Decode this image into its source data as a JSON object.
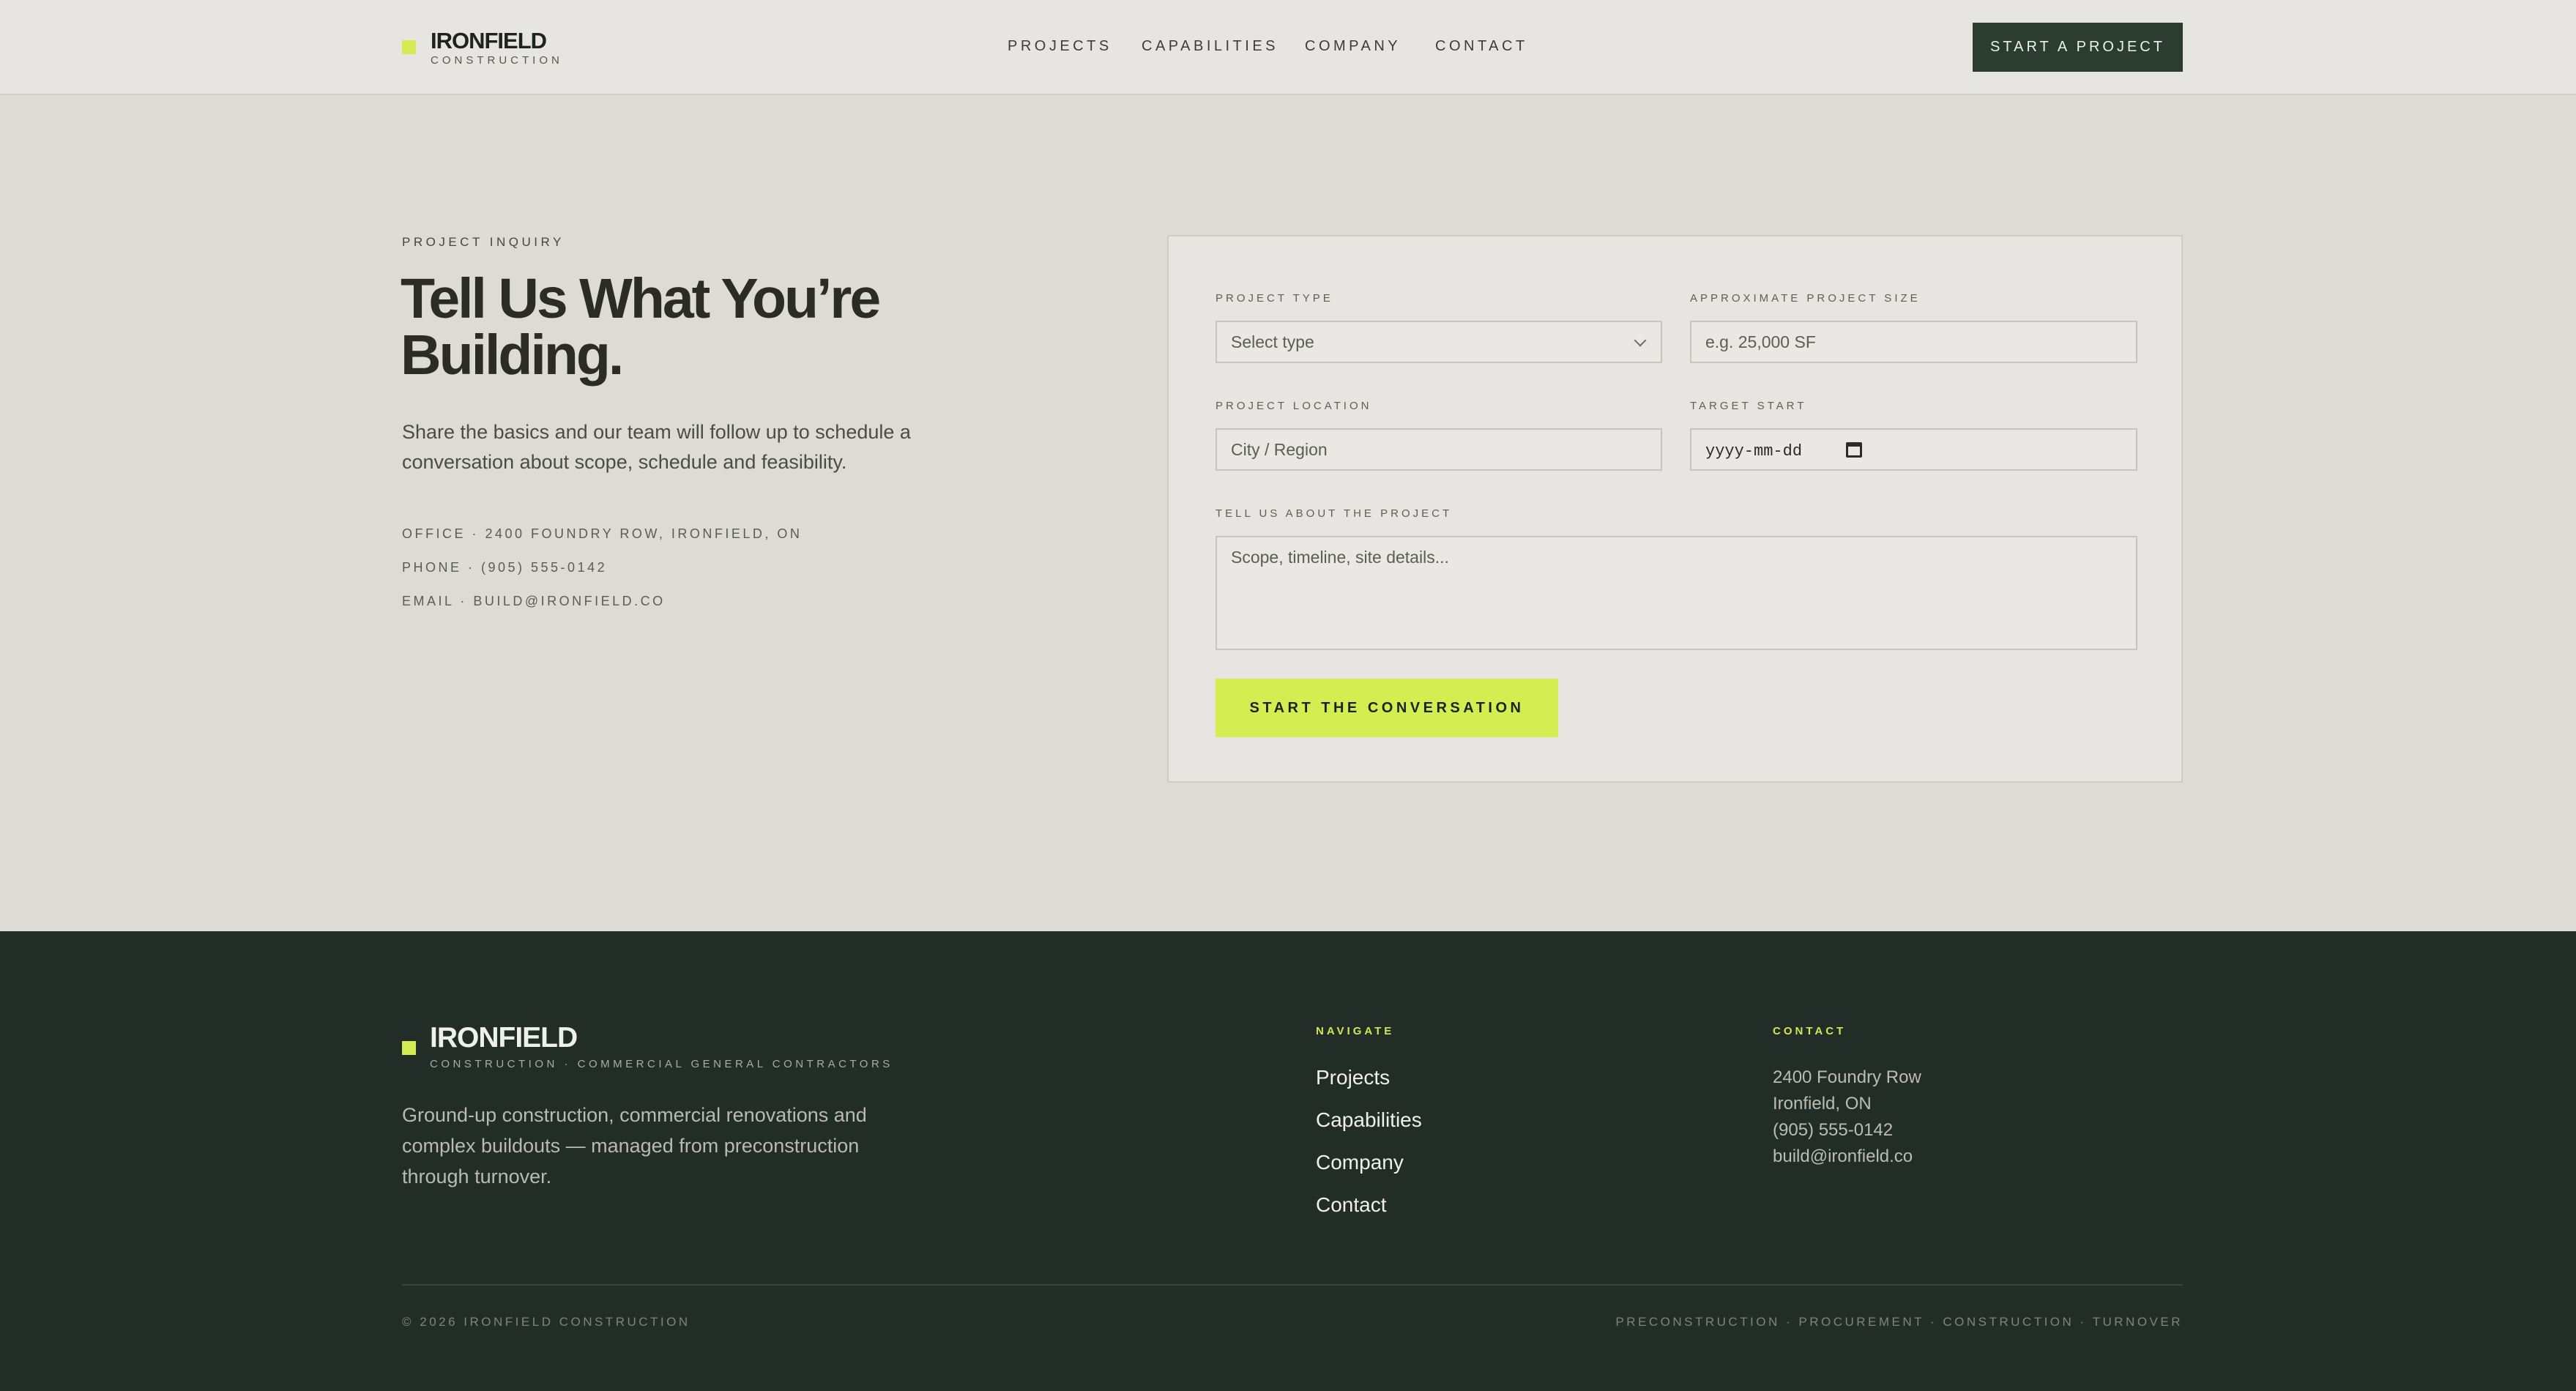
{
  "header": {
    "logo_name": "IRONFIELD",
    "logo_sub": "CONSTRUCTION",
    "nav": [
      "PROJECTS",
      "CAPABILITIES",
      "COMPANY",
      "CONTACT"
    ],
    "cta": "START A PROJECT"
  },
  "hero": {
    "eyebrow": "PROJECT INQUIRY",
    "title": "Tell Us What You’re Building.",
    "subtitle": "Share the basics and our team will follow up to schedule a conversation about scope, schedule and feasibility.",
    "office": "OFFICE · 2400 FOUNDRY ROW, IRONFIELD, ON",
    "phone": "PHONE · (905) 555-0142",
    "email": "EMAIL · BUILD@IRONFIELD.CO"
  },
  "form": {
    "project_type_label": "PROJECT TYPE",
    "project_type_value": "Select type",
    "size_label": "APPROXIMATE PROJECT SIZE",
    "size_placeholder": "e.g. 25,000 SF",
    "location_label": "PROJECT LOCATION",
    "location_placeholder": "City / Region",
    "start_label": "TARGET START",
    "start_placeholder": "yyyy-mm-dd",
    "about_label": "TELL US ABOUT THE PROJECT",
    "about_placeholder": "Scope, timeline, site details...",
    "submit": "START THE CONVERSATION"
  },
  "footer": {
    "logo_name": "IRONFIELD",
    "logo_sub": "CONSTRUCTION · COMMERCIAL GENERAL CONTRACTORS",
    "description": "Ground-up construction, commercial renovations and complex buildouts — managed from preconstruction through turnover.",
    "navigate_title": "NAVIGATE",
    "navigate_links": [
      "Projects",
      "Capabilities",
      "Company",
      "Contact"
    ],
    "contact_title": "CONTACT",
    "contact_lines": [
      "2400 Foundry Row",
      "Ironfield, ON",
      "(905) 555-0142",
      "build@ironfield.co"
    ],
    "copyright": "© 2026 IRONFIELD CONSTRUCTION",
    "services": "PRECONSTRUCTION · PROCUREMENT · CONSTRUCTION · TURNOVER"
  },
  "colors": {
    "accent": "#d2ec52",
    "dark_green": "#2b3c31",
    "footer_bg": "#222d27",
    "page_bg": "#dcdbd6"
  }
}
